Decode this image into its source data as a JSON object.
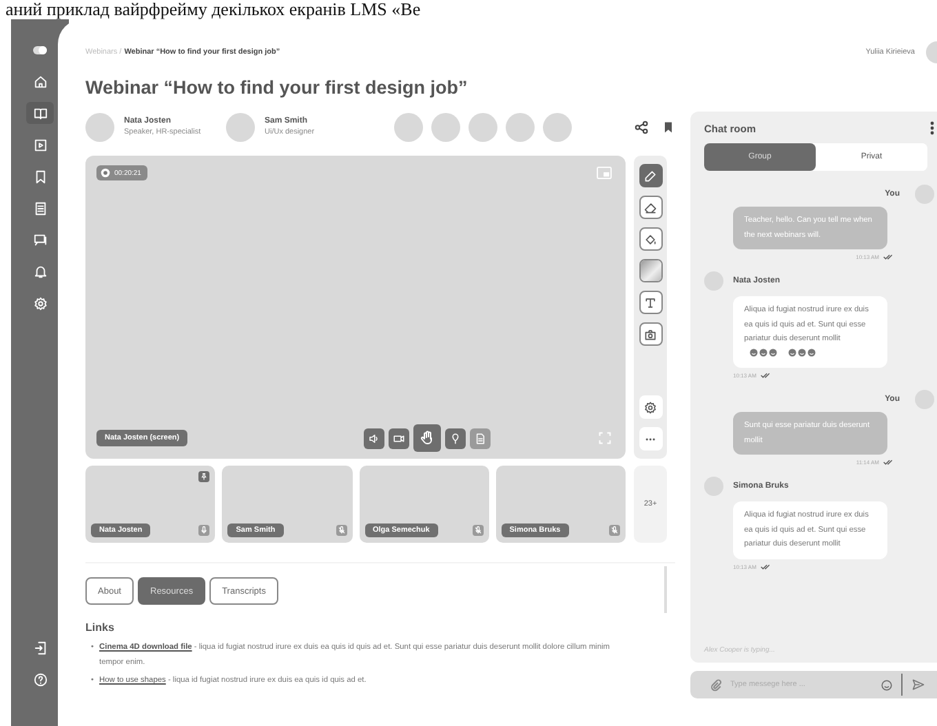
{
  "caption": "аний приклад вайрфрейму декількох екранів LMS «Ве",
  "sidebar": {
    "top_items": [
      {
        "selected": false
      },
      {
        "selected": false
      },
      {
        "selected": true
      },
      {
        "selected": false
      },
      {
        "selected": false
      },
      {
        "selected": false
      },
      {
        "selected": false
      },
      {
        "selected": false
      },
      {
        "selected": false
      }
    ],
    "bottom_items": [
      {
        "selected": false
      },
      {
        "selected": false
      }
    ]
  },
  "breadcrumb": {
    "parent": "Webinars /",
    "current": "Webinar “How to find your first design job”"
  },
  "user": {
    "name": "Yuliia Kirieieva"
  },
  "title": "Webinar “How to find your first design job”",
  "speakers": [
    {
      "name": "Nata Josten",
      "role": "Speaker, HR-specialist"
    },
    {
      "name": "Sam Smith",
      "role": "Ui/Ux designer"
    }
  ],
  "video": {
    "timer": "00:20:21",
    "presenter": "Nata Josten (screen)",
    "controls": [
      {
        "kind": "sound",
        "selected": false,
        "disabled": false
      },
      {
        "kind": "camera",
        "selected": false,
        "disabled": false
      },
      {
        "kind": "hand",
        "selected": true,
        "disabled": false
      },
      {
        "kind": "pin",
        "selected": false,
        "disabled": false
      },
      {
        "kind": "file",
        "selected": false,
        "disabled": true
      }
    ],
    "tools": [
      {
        "kind": "pen",
        "selected": true
      },
      {
        "kind": "eraser",
        "selected": false
      },
      {
        "kind": "fill",
        "selected": false
      },
      {
        "kind": "color",
        "selected": false
      },
      {
        "kind": "text",
        "selected": false
      },
      {
        "kind": "screenshot",
        "selected": false
      },
      {
        "kind": "settings",
        "selected": false
      },
      {
        "kind": "more",
        "selected": false
      }
    ]
  },
  "thumbnails": [
    {
      "name": "Nata Josten",
      "pinned": true,
      "muted": false
    },
    {
      "name": "Sam Smith",
      "pinned": false,
      "muted": true
    },
    {
      "name": "Olga Semechuk",
      "pinned": false,
      "muted": true
    },
    {
      "name": "Simona Bruks",
      "pinned": false,
      "muted": true
    }
  ],
  "more_count": "23+",
  "tabs": [
    {
      "label": "About",
      "selected": false
    },
    {
      "label": "Resources",
      "selected": true
    },
    {
      "label": "Transcripts",
      "selected": false
    }
  ],
  "links": {
    "heading": "Links",
    "items": [
      {
        "bullet": "•",
        "link": "Cinema 4D download file",
        "text": " - liqua id fugiat nostrud irure ex duis ea quis id quis ad et. Sunt qui esse pariatur duis deserunt mollit dolore cillum minim tempor enim."
      },
      {
        "bullet": "•",
        "link": "How to use shapes",
        "text": " - liqua id fugiat nostrud irure ex duis ea quis id quis ad et."
      }
    ]
  },
  "chat": {
    "title": "Chat room",
    "tabs": [
      {
        "label": "Group",
        "selected": true
      },
      {
        "label": "Privat",
        "selected": false
      }
    ],
    "messages": [
      {
        "kind": "outgoing",
        "author": "You",
        "text": "Teacher, hello. Can you tell me when the next webinars will.",
        "time": "10:13 AM",
        "emoji": false
      },
      {
        "kind": "incoming",
        "author": "Nata Josten",
        "text": "Aliqua id fugiat nostrud irure ex duis ea quis id quis ad et. Sunt qui esse pariatur duis deserunt mollit",
        "time": "10:13 AM",
        "emoji": true
      },
      {
        "kind": "outgoing",
        "author": "You",
        "text": "Sunt qui esse pariatur duis deserunt mollit",
        "time": "11:14 AM",
        "emoji": false
      },
      {
        "kind": "incoming",
        "author": "Simona Bruks",
        "text": "Aliqua id fugiat nostrud irure ex duis ea quis id quis ad et. Sunt qui esse pariatur duis deserunt mollit",
        "time": "10:13 AM",
        "emoji": false
      }
    ],
    "typing": "Alex Cooper is typing...",
    "input": {
      "placeholder": "Type messege here ..."
    }
  }
}
